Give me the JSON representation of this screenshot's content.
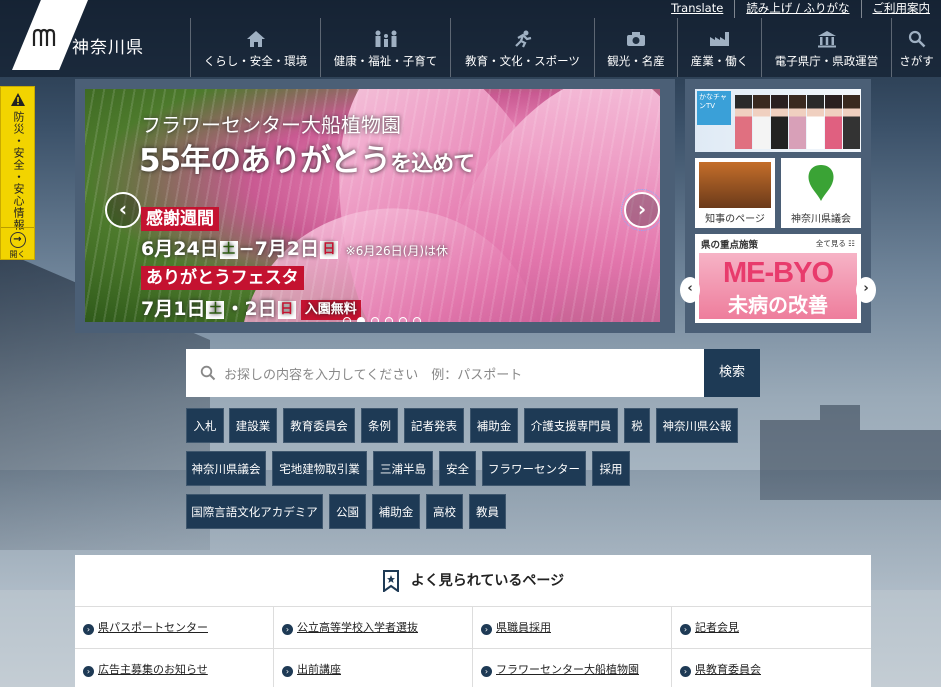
{
  "header": {
    "logo_text": "神奈川県",
    "utility_links": [
      "Translate",
      "読み上げ / ふりがな",
      "ご利用案内"
    ],
    "nav": [
      {
        "label": "くらし・安全・環境",
        "icon": "house-icon"
      },
      {
        "label": "健康・福祉・子育て",
        "icon": "family-icon"
      },
      {
        "label": "教育・文化・スポーツ",
        "icon": "runner-icon"
      },
      {
        "label": "観光・名産",
        "icon": "camera-icon"
      },
      {
        "label": "産業・働く",
        "icon": "factory-icon"
      },
      {
        "label": "電子県庁・県政運営",
        "icon": "government-building-icon"
      },
      {
        "label": "さがす",
        "icon": "search-icon"
      }
    ]
  },
  "disaster_tab": {
    "label": "防災・安全・安心情報",
    "open_label": "開く"
  },
  "slider": {
    "title1": "フラワーセンター大船植物園",
    "title2_a": "55年の",
    "title2_b": "ありがとう",
    "title2_c": "を込めて",
    "badge1": "感謝週間",
    "dates1_a": "6月24日",
    "dates1_day1": "土",
    "dates1_b": "−7月2日",
    "dates1_day2": "日",
    "dates1_note": "※6月26日(月)は休",
    "badge2": "ありがとうフェスタ",
    "dates2_a": "7月1日",
    "dates2_day1": "土",
    "dates2_b": "・2日",
    "dates2_day2": "日",
    "free_label": "入園無料",
    "prev_icon": "chevron-left-icon",
    "next_icon": "chevron-right-icon",
    "dots": 6,
    "active_dot": 2
  },
  "right_panel": {
    "tv_logo": "かなチャンTV",
    "governor_label": "知事のページ",
    "assembly_label": "神奈川県議会",
    "priority_title": "県の重点施策",
    "see_all": "全て見る",
    "mebyo_banner": "ME-BYO",
    "mebyo_sub": "未病の改善"
  },
  "search": {
    "placeholder": "お探しの内容を入力してください　例：パスポート",
    "button_label": "検索"
  },
  "tags": {
    "row1": [
      "入札",
      "建設業",
      "教育委員会",
      "条例",
      "記者発表",
      "補助金",
      "介護支援専門員",
      "税",
      "神奈川県公報"
    ],
    "row2": [
      "神奈川県議会",
      "宅地建物取引業",
      "三浦半島",
      "安全",
      "フラワーセンター",
      "採用"
    ],
    "row3": [
      "国際言語文化アカデミア",
      "公園",
      "補助金",
      "高校",
      "教員"
    ]
  },
  "popular": {
    "title": "よく見られているページ",
    "items": [
      "県パスポートセンター",
      "公立高等学校入学者選抜",
      "県職員採用",
      "記者会見",
      "広告主募集のお知らせ",
      "出前講座",
      "フラワーセンター大船植物園",
      "県教育委員会"
    ]
  },
  "colors": {
    "header_bg": "#14202f",
    "accent_navy": "#1e3a55",
    "disaster_yellow": "#f2d400",
    "badge_red": "#c41230"
  }
}
